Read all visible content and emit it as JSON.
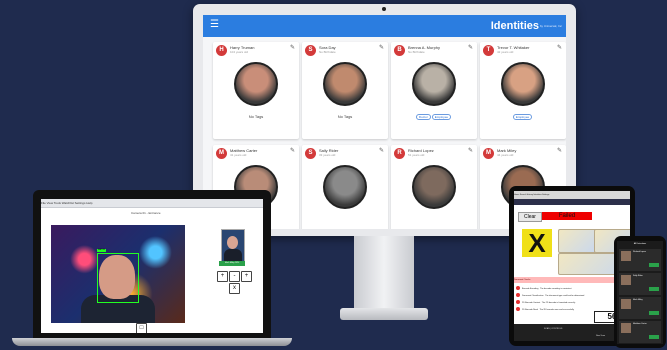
{
  "identities_app": {
    "menu_icon": "menu-icon",
    "title": "Identities",
    "subtitle": "by Universal, Inc",
    "cards": [
      {
        "initial": "H",
        "name": "Harry Truman",
        "age": "104 years old",
        "tags_text": "No Tags",
        "chips": [],
        "face_color": "#c98e79"
      },
      {
        "initial": "S",
        "name": "Sora Day",
        "age": "No Birthdate",
        "tags_text": "No Tags",
        "chips": [],
        "face_color": "#c08a6e"
      },
      {
        "initial": "B",
        "name": "Brenna A. Murphy",
        "age": "No Birthdate",
        "tags_text": "",
        "chips": [
          "Doctor",
          "Employee"
        ],
        "face_color": "#b9b1a6"
      },
      {
        "initial": "T",
        "name": "Trevor T. Whitaker",
        "age": "42 years old",
        "tags_text": "",
        "chips": [
          "Employee"
        ],
        "face_color": "#d8a183"
      },
      {
        "initial": "M",
        "name": "Matthew Carter",
        "age": "41 years old",
        "tags_text": "",
        "chips": [],
        "face_color": "#b98c78"
      },
      {
        "initial": "S",
        "name": "Sally Rider",
        "age": "33 years old",
        "tags_text": "",
        "chips": [],
        "face_color": "#8a8a8a"
      },
      {
        "initial": "R",
        "name": "Richard Lopez",
        "age": "51 years old",
        "tags_text": "",
        "chips": [],
        "face_color": "#7e6a5e"
      },
      {
        "initial": "M",
        "name": "Mark Miley",
        "age": "44 years old",
        "tags_text": "",
        "chips": [],
        "face_color": "#9a6b52"
      }
    ],
    "edit_icon": "pencil-icon"
  },
  "laptop": {
    "toolbar_text": "File   View   Tools   Watchlist   Settings   Help",
    "panel_title": "Camera 01 - Entrance",
    "detection_label": "MATCH",
    "match_label": "Mark Miley 98%",
    "buttons": [
      "+",
      "-",
      "+",
      "x",
      "□"
    ]
  },
  "tablet": {
    "bar_text": "Home   Search   History   Identities   Settings",
    "clear_label": "Clear",
    "status_label": "Failed",
    "x_mark": "X",
    "strip_text": "Document Checks",
    "rows": [
      {
        "left": "Barcode Encoding",
        "right": "The barcode encoding is consistent"
      },
      {
        "left": "Document Classification",
        "right": "The document type could not be determined"
      },
      {
        "left": "2D Barcode Content",
        "right": "The 2D barcode is formatted correctly"
      },
      {
        "left": "2D Barcode Read",
        "right": "The 2D barcode was read successfully"
      }
    ],
    "score": "56",
    "footer_left": "SCAN  |  CONTROLS",
    "footer_right": "New Scan"
  },
  "phone": {
    "title": "All Detections",
    "items": [
      {
        "title": "Richard Lopez"
      },
      {
        "title": "Sally Rider"
      },
      {
        "title": "Mark Miley"
      },
      {
        "title": "Matthew Carter"
      }
    ]
  },
  "colors": {
    "background": "#1f2b4e",
    "app_bar": "#2b7de0",
    "avatar": "#d33a3a",
    "failed": "#e00000"
  }
}
